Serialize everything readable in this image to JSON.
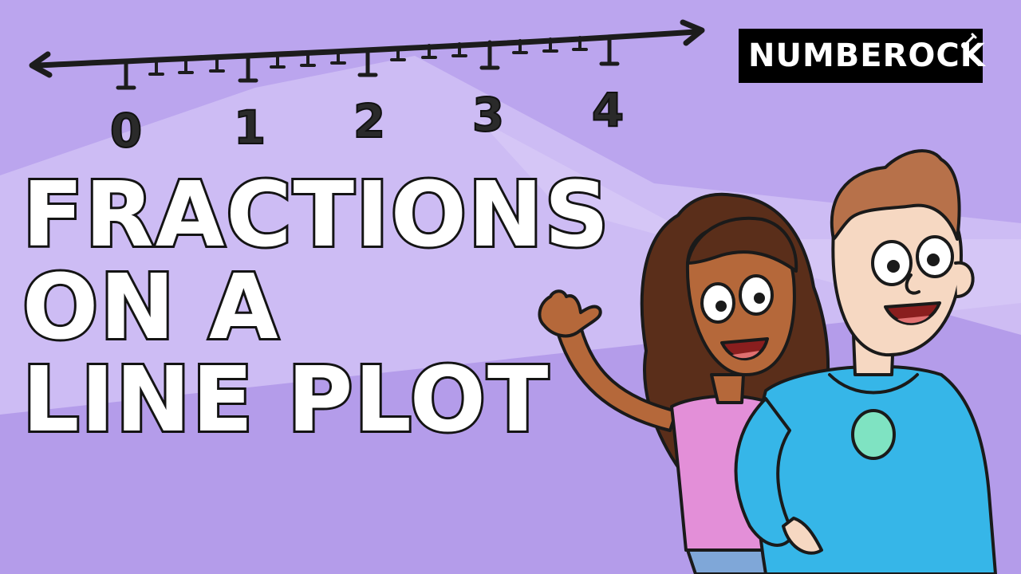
{
  "title": {
    "lines": [
      "FRACTIONS",
      "ON A",
      "LINE PLOT"
    ]
  },
  "brand": {
    "name": "NUMBEROCK",
    "icon": "guitar-icon"
  },
  "number_line": {
    "labels": [
      "0",
      "1",
      "2",
      "3",
      "4"
    ]
  },
  "colors": {
    "background": "#b9a3ec",
    "background_light": "#d6c8f6",
    "girl_shirt": "#e38fd8",
    "boy_hoodie": "#36b6e8",
    "hoodie_badge": "#7fe3c2"
  }
}
